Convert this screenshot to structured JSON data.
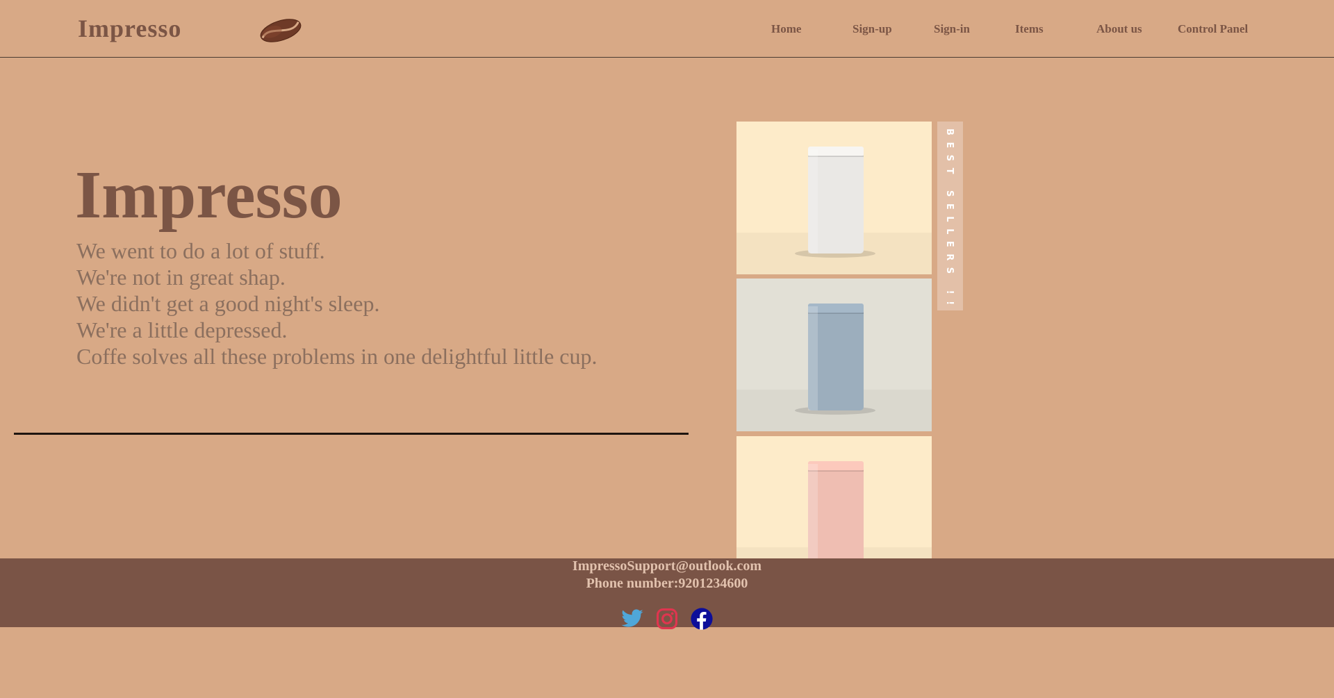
{
  "header": {
    "brand": "Impresso",
    "logo_icon": "coffee-bean-icon",
    "nav": [
      {
        "label": "Home"
      },
      {
        "label": "Sign-up"
      },
      {
        "label": "Sign-in"
      },
      {
        "label": "Items"
      },
      {
        "label": "About us"
      },
      {
        "label": "Control Panel"
      }
    ]
  },
  "hero": {
    "title": "Impresso",
    "lines": [
      "We went to do a lot of stuff.",
      "We're not in great shap.",
      "We didn't get a good night's sleep.",
      "We're a little depressed.",
      "Coffe solves all these problems in one delightful little cup."
    ]
  },
  "bestsellers": {
    "label": "BEST SELLERS !!",
    "products": [
      {
        "bag_color": "#f7f5f2",
        "backdrop": "#fdebc9"
      },
      {
        "bag_color": "#a5b8c8",
        "backdrop": "#e2e0d6"
      },
      {
        "bag_color": "#fcc9bc",
        "backdrop": "#fdebc9"
      }
    ]
  },
  "footer": {
    "email": "ImpressoSupport@outlook.com",
    "phone": "Phone number:9201234600",
    "social": [
      {
        "icon": "twitter-icon",
        "color": "#4fa7d9"
      },
      {
        "icon": "instagram-icon",
        "color": "#e0354f"
      },
      {
        "icon": "facebook-icon",
        "color": "#0d0e9a"
      }
    ]
  },
  "colors": {
    "background": "#d8a986",
    "brand_brown": "#7b5545",
    "footer_bg": "#7a5446"
  }
}
